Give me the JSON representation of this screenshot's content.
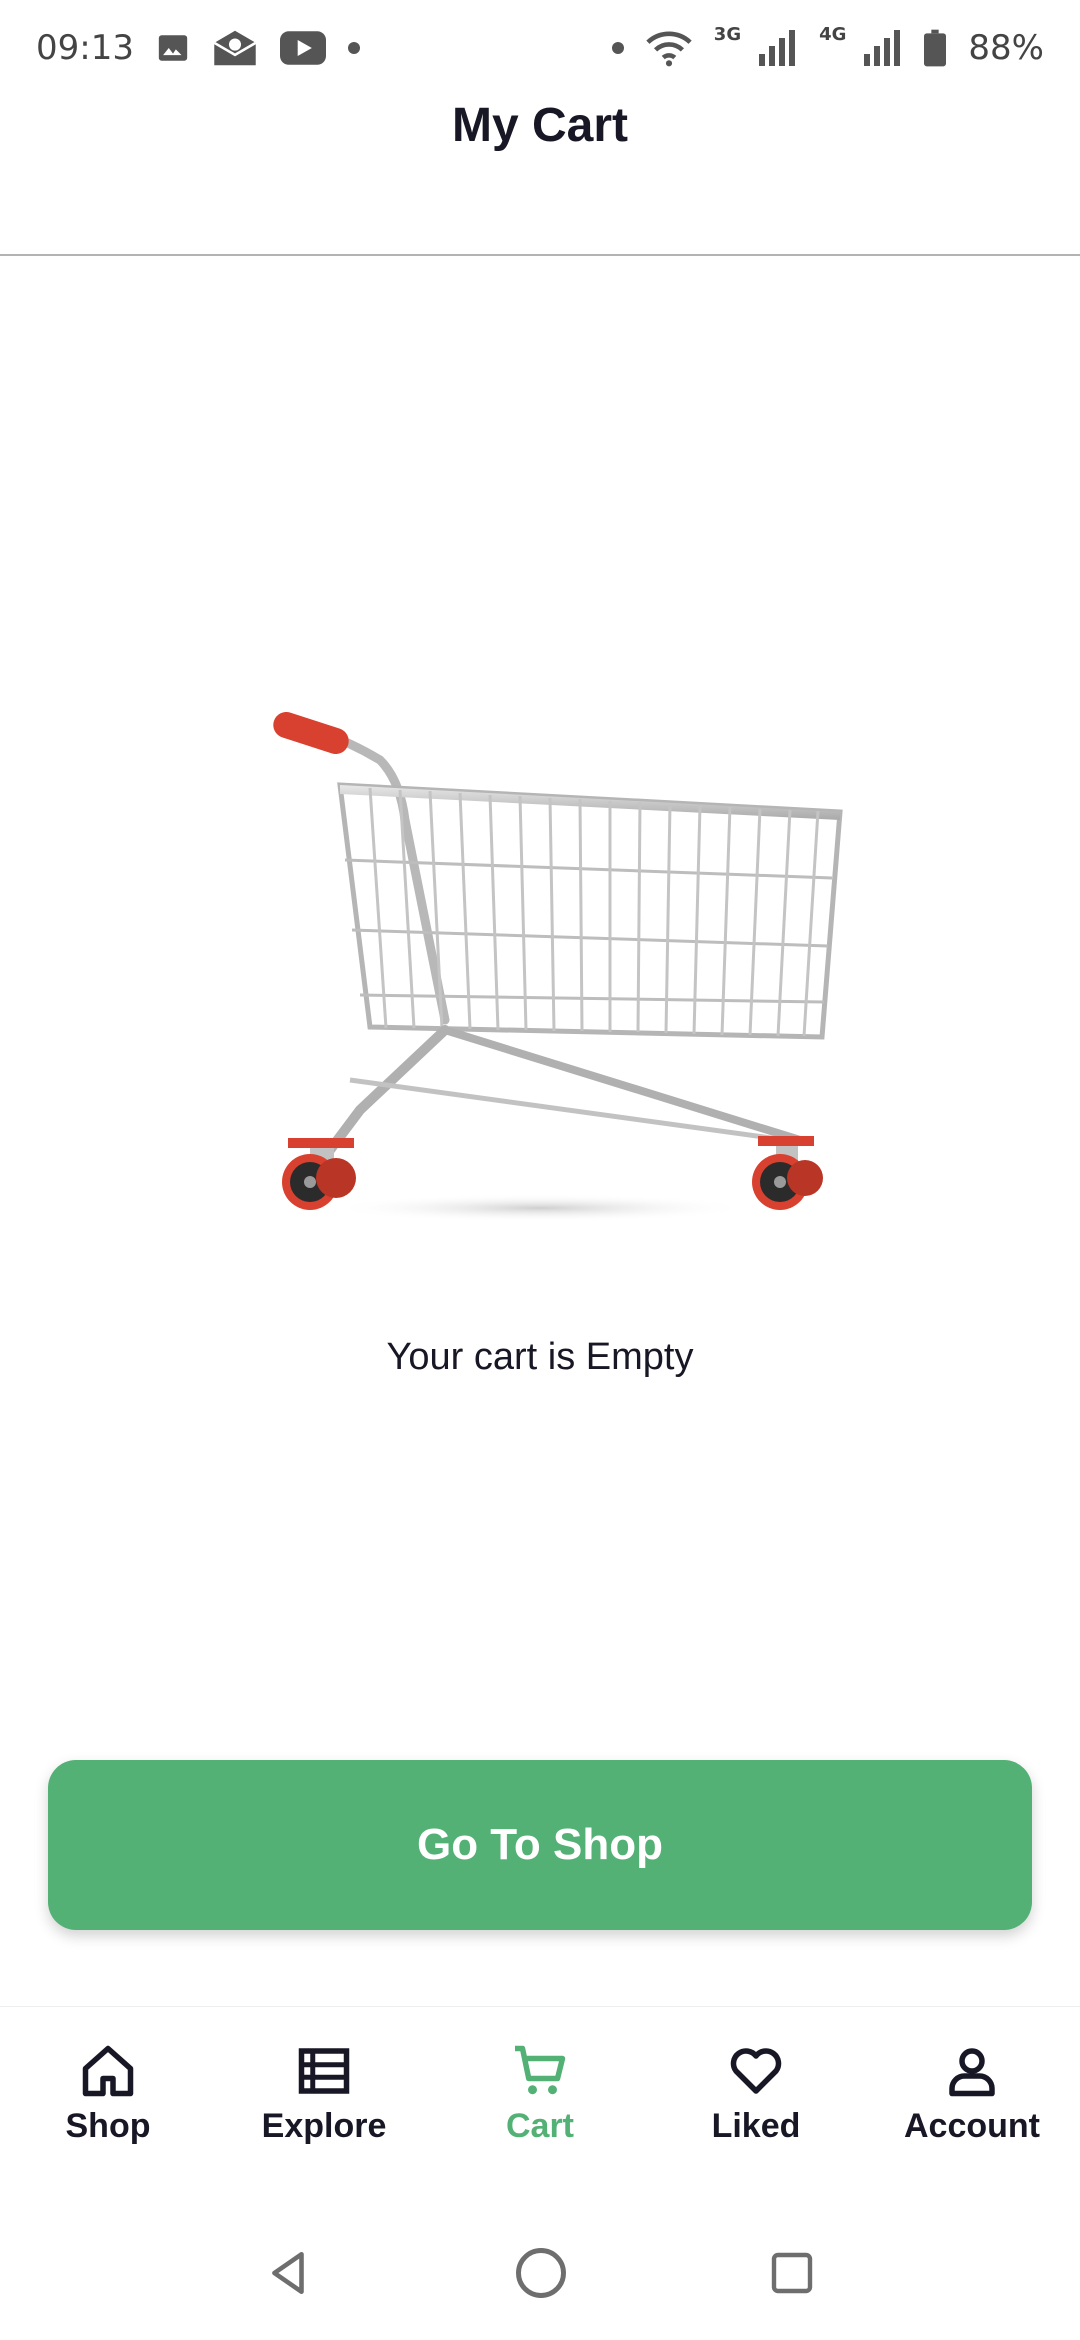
{
  "status_bar": {
    "time": "09:13",
    "net_3g": "3G",
    "net_4g": "4G",
    "battery": "88%",
    "icons": [
      "gallery-icon",
      "mail-icon",
      "youtube-icon",
      "wifi-icon",
      "signal-icon",
      "battery-icon"
    ]
  },
  "header": {
    "title": "My Cart"
  },
  "main": {
    "illustration": "shopping-cart-icon",
    "empty_message": "Your cart is Empty",
    "cta_label": "Go To Shop"
  },
  "nav": {
    "items": [
      {
        "label": "Shop",
        "icon": "home-icon",
        "active": false
      },
      {
        "label": "Explore",
        "icon": "list-icon",
        "active": false
      },
      {
        "label": "Cart",
        "icon": "cart-icon",
        "active": true
      },
      {
        "label": "Liked",
        "icon": "heart-icon",
        "active": false
      },
      {
        "label": "Account",
        "icon": "person-icon",
        "active": false
      }
    ]
  },
  "colors": {
    "accent": "#53b175",
    "text": "#181725",
    "cart_red": "#d8412f"
  }
}
